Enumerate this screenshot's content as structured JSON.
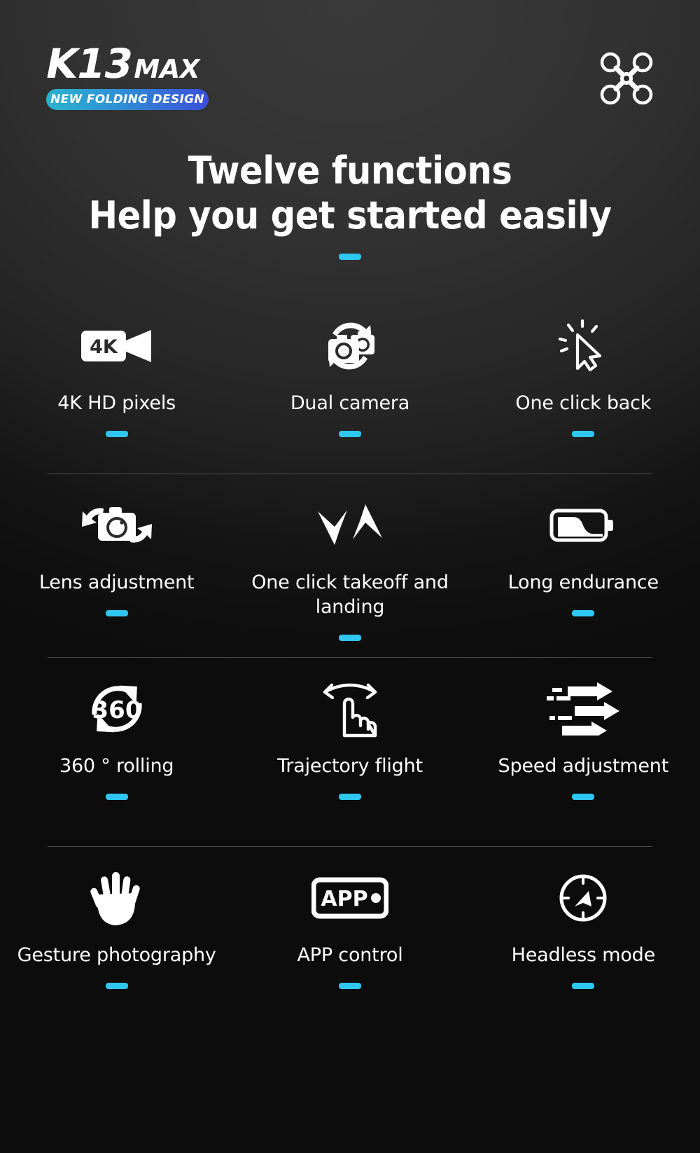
{
  "header": {
    "logo_model": "K13",
    "logo_suffix": "MAX",
    "badge_text": "NEW FOLDING DESIGN",
    "drone_icon": "drone-icon",
    "badge_gradient_start": "#2bb3cf",
    "badge_gradient_end": "#3b4fd8"
  },
  "title": {
    "line1": "Twelve functions",
    "line2": "Help you get started easily"
  },
  "theme": {
    "background": "#2b2b2b",
    "accent": "#2ec7f0",
    "text": "#ffffff",
    "divider": "#4a4a4a"
  },
  "features": [
    [
      {
        "label": "4K HD pixels",
        "icon": "video-4k-icon"
      },
      {
        "label": "Dual camera",
        "icon": "dual-camera-icon"
      },
      {
        "label": "One click back",
        "icon": "click-cursor-icon"
      }
    ],
    [
      {
        "label": "Lens adjustment",
        "icon": "camera-rotate-icon"
      },
      {
        "label": "One click takeoff and landing",
        "icon": "takeoff-landing-arrows-icon"
      },
      {
        "label": "Long endurance",
        "icon": "battery-icon"
      }
    ],
    [
      {
        "label": "360 ° rolling",
        "icon": "rotate-360-icon",
        "icon_text": "360"
      },
      {
        "label": "Trajectory flight",
        "icon": "swipe-hand-icon"
      },
      {
        "label": "Speed adjustment",
        "icon": "speed-lines-icon"
      }
    ],
    [
      {
        "label": "Gesture photography",
        "icon": "open-hand-icon"
      },
      {
        "label": "APP control",
        "icon": "app-tablet-icon",
        "icon_text": "APP"
      },
      {
        "label": "Headless mode",
        "icon": "compass-icon"
      }
    ]
  ]
}
